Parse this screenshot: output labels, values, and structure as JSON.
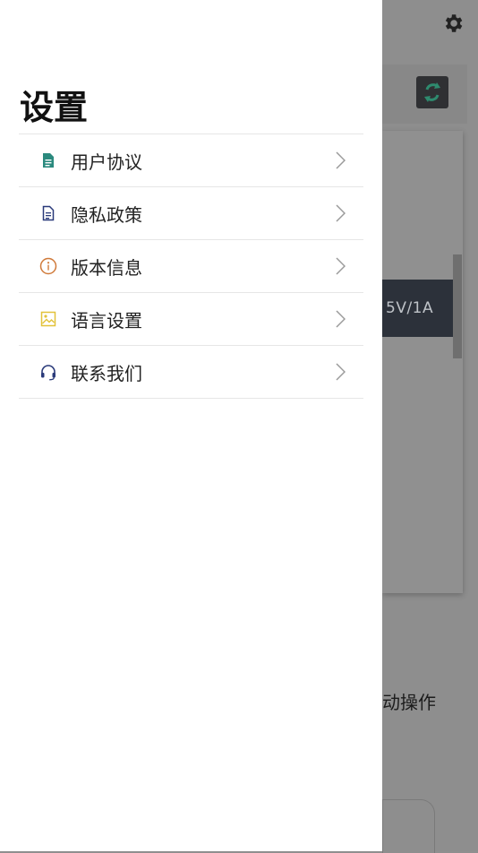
{
  "background": {
    "spec_label": "5V/1A",
    "partial_text": "动操作"
  },
  "drawer": {
    "title": "设置",
    "items": [
      {
        "label": "用户协议",
        "icon": "document-filled-icon",
        "color": "#2b8a7e"
      },
      {
        "label": "隐私政策",
        "icon": "document-outline-icon",
        "color": "#2a3a7a"
      },
      {
        "label": "版本信息",
        "icon": "info-circle-icon",
        "color": "#d07a3a"
      },
      {
        "label": "语言设置",
        "icon": "image-icon",
        "color": "#e2c23a"
      },
      {
        "label": "联系我们",
        "icon": "headset-icon",
        "color": "#2a3a7a"
      }
    ]
  }
}
